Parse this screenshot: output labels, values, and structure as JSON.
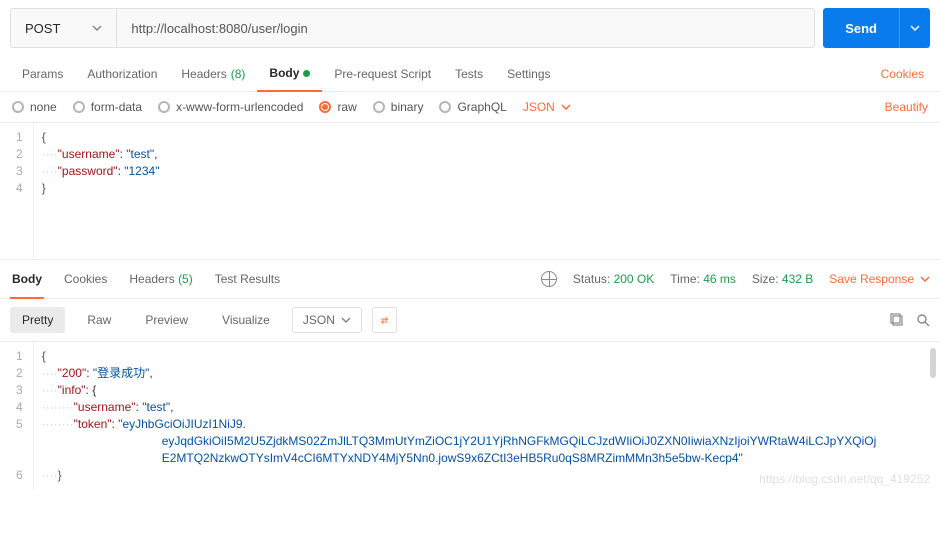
{
  "request": {
    "method": "POST",
    "url": "http://localhost:8080/user/login",
    "sendLabel": "Send"
  },
  "reqTabs": {
    "params": "Params",
    "authorization": "Authorization",
    "headers": "Headers",
    "headersCount": "(8)",
    "body": "Body",
    "preRequest": "Pre-request Script",
    "tests": "Tests",
    "settings": "Settings",
    "cookies": "Cookies"
  },
  "bodyTypes": {
    "none": "none",
    "formData": "form-data",
    "urlencoded": "x-www-form-urlencoded",
    "raw": "raw",
    "binary": "binary",
    "graphql": "GraphQL",
    "formatSelected": "JSON",
    "beautify": "Beautify"
  },
  "requestBody": {
    "line1": "{",
    "line2_key": "\"username\"",
    "line2_val": "\"test\"",
    "line3_key": "\"password\"",
    "line3_val": "\"1234\"",
    "line4": "}"
  },
  "respTabs": {
    "body": "Body",
    "cookies": "Cookies",
    "headers": "Headers",
    "headersCount": "(5)",
    "testResults": "Test Results"
  },
  "responseMeta": {
    "statusLabel": "Status:",
    "statusValue": "200 OK",
    "timeLabel": "Time:",
    "timeValue": "46 ms",
    "sizeLabel": "Size:",
    "sizeValue": "432 B",
    "saveResponse": "Save Response"
  },
  "viewControls": {
    "pretty": "Pretty",
    "raw": "Raw",
    "preview": "Preview",
    "visualize": "Visualize",
    "format": "JSON"
  },
  "responseBody": {
    "line1": "{",
    "line2_key": "\"200\"",
    "line2_val": "\"登录成功\"",
    "line3_key": "\"info\"",
    "line4_key": "\"username\"",
    "line4_val": "\"test\"",
    "line5_key": "\"token\"",
    "line5_val_a": "\"eyJhbGciOiJIUzI1NiJ9.",
    "line5_val_b": "eyJqdGkiOiI5M2U5ZjdkMS02ZmJlLTQ3MmUtYmZiOC1jY2U1YjRhNGFkMGQiLCJzdWIiOiJ0ZXN0IiwiaXNzIjoiYWRtaW4iLCJpYXQiOj",
    "line5_val_c": "E2MTQ2NzkwOTYsImV4cCI6MTYxNDY4MjY5Nn0.jowS9x6ZCtI3eHB5Ru0qS8MRZimMMn3h5e5bw-Kecp4\"",
    "line6": "}"
  },
  "watermark": "https://blog.csdn.net/qq_419252"
}
